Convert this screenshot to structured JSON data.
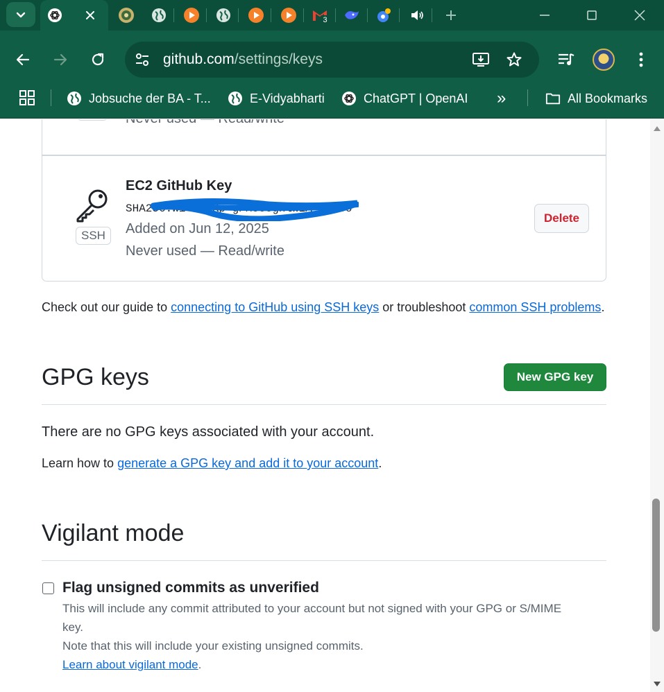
{
  "browser": {
    "tabs": [
      {
        "icon": "chatgpt-icon",
        "active": true
      },
      {
        "icon": "site-emblem-icon"
      },
      {
        "icon": "globe-icon"
      },
      {
        "icon": "orange-app-icon"
      },
      {
        "icon": "globe-icon"
      },
      {
        "icon": "orange-app-icon"
      },
      {
        "icon": "orange-app-icon"
      },
      {
        "icon": "gmail-icon",
        "badge": "3"
      },
      {
        "icon": "deepseek-icon"
      },
      {
        "icon": "colorful-app-icon"
      },
      {
        "icon": "speaker-icon"
      }
    ],
    "url_host": "github.com",
    "url_path": "/settings/keys",
    "bookmarks": [
      {
        "label": "Jobsuche der BA - T...",
        "icon": "globe-icon"
      },
      {
        "label": "E-Vidyabharti",
        "icon": "globe-icon"
      },
      {
        "label": "ChatGPT | OpenAI",
        "icon": "chatgpt-icon"
      }
    ],
    "overflow_label": "»",
    "all_bookmarks_label": "All Bookmarks",
    "colors": {
      "chrome_dark": "#0b4f3a",
      "chrome": "#0f5e45"
    }
  },
  "ssh_keys": {
    "previous_key_usage": "Never used — Read/write",
    "key": {
      "type_badge": "SSH",
      "title": "EC2 GitHub Key",
      "fingerprint": "SHA256:wi                    eu/Kp g/MoccgnlW1A  SHt6o",
      "added": "Added on Jun 12, 2025",
      "usage": "Never used — Read/write",
      "delete_label": "Delete"
    },
    "guide": {
      "prefix": "Check out our guide to ",
      "link1": "connecting to GitHub using SSH keys",
      "middle": " or troubleshoot ",
      "link2": "common SSH problems",
      "suffix": "."
    }
  },
  "gpg_keys": {
    "title": "GPG keys",
    "new_button": "New GPG key",
    "empty_message": "There are no GPG keys associated with your account.",
    "learn_prefix": "Learn how to ",
    "learn_link": "generate a GPG key and add it to your account",
    "learn_suffix": "."
  },
  "vigilant_mode": {
    "title": "Vigilant mode",
    "checkbox_label": "Flag unsigned commits as unverified",
    "checked": false,
    "description_line1": "This will include any commit attributed to your account but not signed with your GPG or S/MIME",
    "description_line2": "key.",
    "note": "Note that this will include your existing unsigned commits.",
    "learn_link": "Learn about vigilant mode",
    "learn_suffix": "."
  },
  "colors": {
    "primary_green": "#1f883d",
    "danger_red": "#cf222e",
    "link_blue": "#0969da"
  }
}
